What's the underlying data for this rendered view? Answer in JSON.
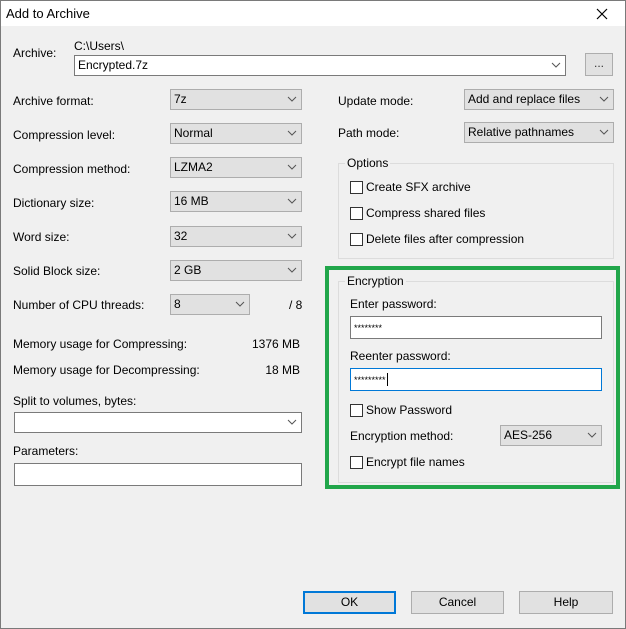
{
  "window": {
    "title": "Add to Archive",
    "close_icon": "close-icon"
  },
  "archive": {
    "label": "Archive:",
    "path": "C:\\Users\\",
    "filename": "Encrypted.7z",
    "browse_label": "..."
  },
  "left": {
    "archive_format": {
      "label": "Archive format:",
      "value": "7z"
    },
    "compression_level": {
      "label": "Compression level:",
      "value": "Normal"
    },
    "compression_method": {
      "label": "Compression method:",
      "value": "LZMA2"
    },
    "dictionary_size": {
      "label": "Dictionary size:",
      "value": "16 MB"
    },
    "word_size": {
      "label": "Word size:",
      "value": "32"
    },
    "solid_block_size": {
      "label": "Solid Block size:",
      "value": "2 GB"
    },
    "cpu_threads": {
      "label": "Number of CPU threads:",
      "value": "8",
      "max": "/ 8"
    },
    "mem_compress": {
      "label": "Memory usage for Compressing:",
      "value": "1376 MB"
    },
    "mem_decompress": {
      "label": "Memory usage for Decompressing:",
      "value": "18 MB"
    },
    "split_volumes": {
      "label": "Split to volumes, bytes:",
      "value": ""
    },
    "parameters": {
      "label": "Parameters:",
      "value": ""
    }
  },
  "right": {
    "update_mode": {
      "label": "Update mode:",
      "value": "Add and replace files"
    },
    "path_mode": {
      "label": "Path mode:",
      "value": "Relative pathnames"
    },
    "options": {
      "title": "Options",
      "items": [
        {
          "label": "Create SFX archive",
          "checked": false
        },
        {
          "label": "Compress shared files",
          "checked": false
        },
        {
          "label": "Delete files after compression",
          "checked": false
        }
      ]
    },
    "encryption": {
      "title": "Encryption",
      "enter_label": "Enter password:",
      "enter_value": "********",
      "reenter_label": "Reenter password:",
      "reenter_value": "*********",
      "show_password": {
        "label": "Show Password",
        "checked": false
      },
      "method_label": "Encryption method:",
      "method_value": "AES-256",
      "encrypt_names": {
        "label": "Encrypt file names",
        "checked": false
      },
      "highlight_color": "#21a64a"
    }
  },
  "buttons": {
    "ok": "OK",
    "cancel": "Cancel",
    "help": "Help"
  }
}
